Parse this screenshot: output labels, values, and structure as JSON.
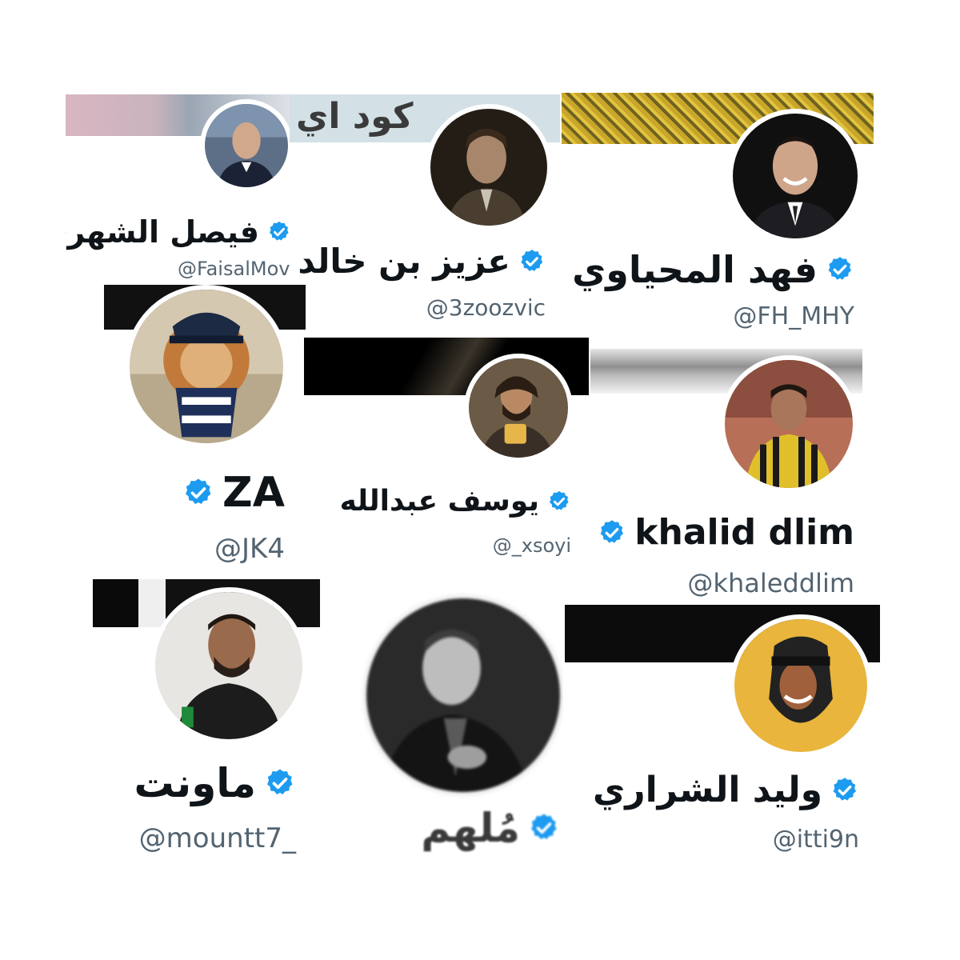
{
  "accent": "#1d9bf0",
  "profiles": [
    {
      "name": "فيصل الشهري",
      "handle": "@FaisalMov"
    },
    {
      "name": "عزيز بن خالد",
      "handle": "@3zoozvic",
      "banner_text": "كود اي"
    },
    {
      "name": "فهد المحياوي",
      "handle": "@FH_MHY"
    },
    {
      "name": "ZA",
      "handle": "@JK4"
    },
    {
      "name": "يوسف عبدالله",
      "handle": "@_xsoyi"
    },
    {
      "name": "khalid dlim",
      "handle": "@khaleddlim"
    },
    {
      "name": "ماونت",
      "handle": "@mountt7_"
    },
    {
      "name": "مُلهم",
      "handle": ""
    },
    {
      "name": "وليد الشراري",
      "handle": "@itti9n"
    }
  ]
}
